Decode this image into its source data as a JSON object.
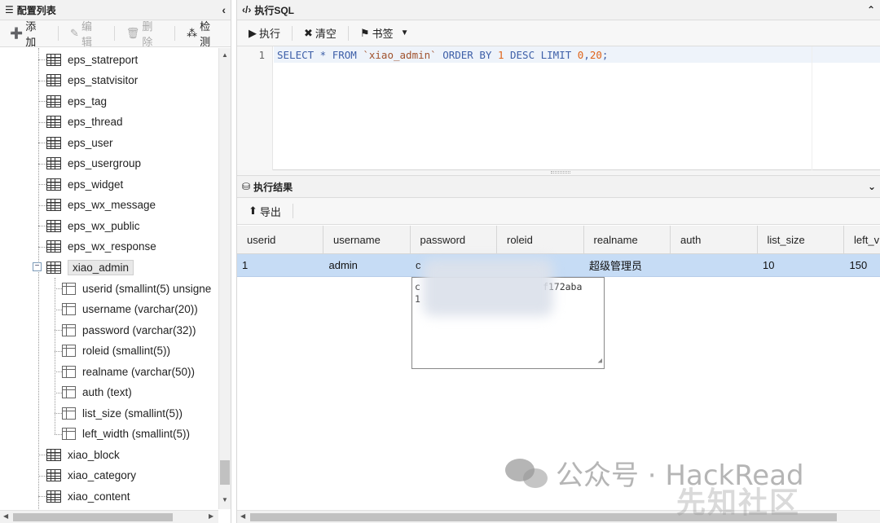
{
  "left": {
    "title": "配置列表",
    "toolbar": {
      "add": "添加",
      "edit": "编辑",
      "delete": "删除",
      "check": "检测"
    },
    "tables_top": [
      "eps_statreport",
      "eps_statvisitor",
      "eps_tag",
      "eps_thread",
      "eps_user",
      "eps_usergroup",
      "eps_widget",
      "eps_wx_message",
      "eps_wx_public",
      "eps_wx_response"
    ],
    "selected_table": "xiao_admin",
    "columns": [
      "userid (smallint(5) unsigne",
      "username (varchar(20))",
      "password (varchar(32))",
      "roleid (smallint(5))",
      "realname (varchar(50))",
      "auth (text)",
      "list_size (smallint(5))",
      "left_width (smallint(5))"
    ],
    "tables_bottom": [
      "xiao_block",
      "xiao_category",
      "xiao_content"
    ]
  },
  "sql": {
    "title": "执行SQL",
    "toolbar": {
      "run": "执行",
      "clear": "清空",
      "bookmark": "书签"
    },
    "line_number": "1",
    "query": {
      "p1": "SELECT * FROM ",
      "table": "`xiao_admin`",
      "p2": " ORDER BY ",
      "n1": "1",
      "p3": " DESC LIMIT ",
      "n2": "0",
      "p4": ",",
      "n3": "20",
      "p5": ";"
    }
  },
  "result": {
    "title": "执行结果",
    "export": "导出",
    "headers": [
      "userid",
      "username",
      "password",
      "roleid",
      "realname",
      "auth",
      "list_size",
      "left_v"
    ],
    "row": [
      "1",
      "admin",
      "c",
      "",
      "超级管理员",
      "",
      "10",
      "150"
    ],
    "popup_line1": "c",
    "popup_line1_end": "f172aba",
    "popup_line2": "1"
  },
  "watermark": {
    "text": "公众号 · HackRead",
    "text2": "先知社区"
  }
}
